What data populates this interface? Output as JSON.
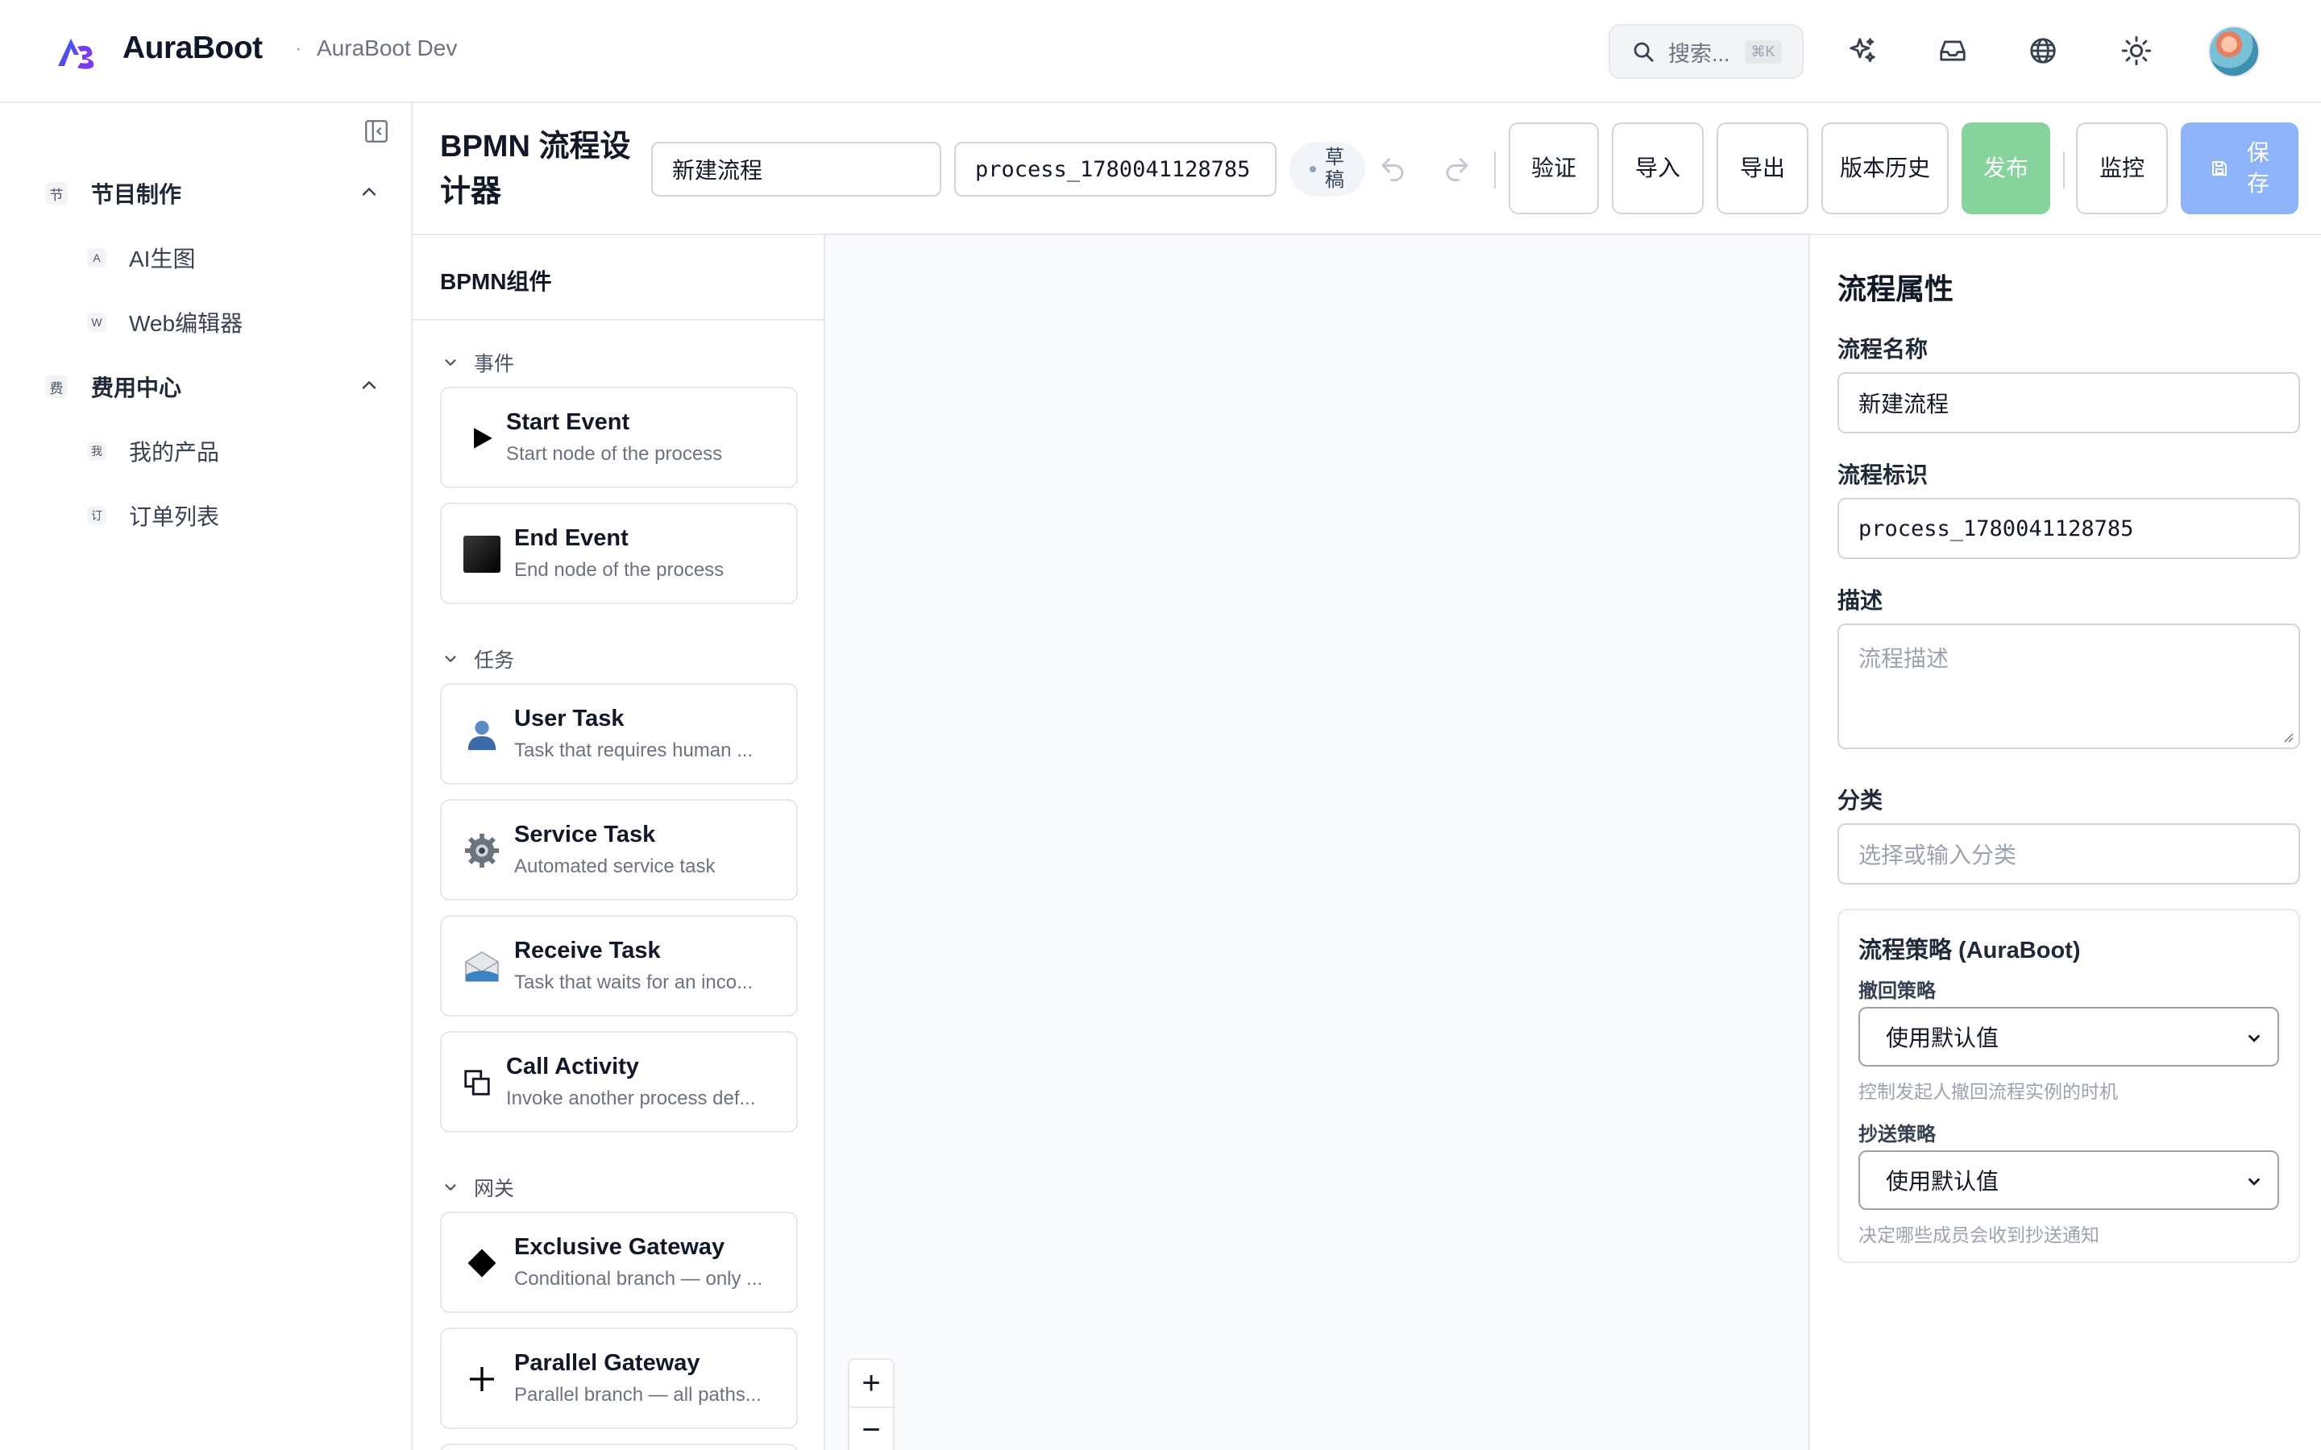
{
  "header": {
    "brand": "AuraBoot",
    "env_separator": "·",
    "env": "AuraBoot Dev",
    "search_placeholder": "搜索...",
    "search_shortcut": "⌘K",
    "icons": [
      "sparkle-icon",
      "inbox-icon",
      "globe-icon",
      "sun-icon"
    ]
  },
  "sidebar": {
    "groups": [
      {
        "badge": "节",
        "label": "节目制作",
        "items": [
          {
            "badge": "A",
            "label": "AI生图"
          },
          {
            "badge": "W",
            "label": "Web编辑器"
          }
        ]
      },
      {
        "badge": "费",
        "label": "费用中心",
        "items": [
          {
            "badge": "我",
            "label": "我的产品"
          },
          {
            "badge": "订",
            "label": "订单列表"
          }
        ]
      }
    ]
  },
  "toolbar": {
    "title": "BPMN 流程设计器",
    "process_name": "新建流程",
    "process_key": "process_1780041128785",
    "status": "草稿",
    "buttons": {
      "validate": "验证",
      "import": "导入",
      "export": "导出",
      "history": "版本历史",
      "publish": "发布",
      "monitor": "监控",
      "save": "保存"
    }
  },
  "palette": {
    "title": "BPMN组件",
    "sections": [
      {
        "label": "事件",
        "items": [
          {
            "name": "Start Event",
            "desc": "Start node of the process",
            "icon": "play-triangle-icon"
          },
          {
            "name": "End Event",
            "desc": "End node of the process",
            "icon": "black-square-icon"
          }
        ]
      },
      {
        "label": "任务",
        "items": [
          {
            "name": "User Task",
            "desc": "Task that requires human ...",
            "icon": "user-icon"
          },
          {
            "name": "Service Task",
            "desc": "Automated service task",
            "icon": "gear-icon"
          },
          {
            "name": "Receive Task",
            "desc": "Task that waits for an inco...",
            "icon": "envelope-icon"
          },
          {
            "name": "Call Activity",
            "desc": "Invoke another process def...",
            "icon": "overlap-squares-icon"
          }
        ]
      },
      {
        "label": "网关",
        "items": [
          {
            "name": "Exclusive Gateway",
            "desc": "Conditional branch — only ...",
            "icon": "diamond-icon"
          },
          {
            "name": "Parallel Gateway",
            "desc": "Parallel branch — all paths...",
            "icon": "plus-icon"
          }
        ]
      }
    ]
  },
  "canvas": {
    "zoom_in": "+",
    "zoom_out": "−"
  },
  "properties": {
    "title": "流程属性",
    "name_label": "流程名称",
    "name_value": "新建流程",
    "key_label": "流程标识",
    "key_value": "process_1780041128785",
    "desc_label": "描述",
    "desc_placeholder": "流程描述",
    "category_label": "分类",
    "category_placeholder": "选择或输入分类",
    "strategy": {
      "title": "流程策略 (AuraBoot)",
      "withdraw_label": "撤回策略",
      "withdraw_value": "使用默认值",
      "withdraw_help": "控制发起人撤回流程实例的时机",
      "cc_label": "抄送策略",
      "cc_value": "使用默认值",
      "cc_help": "决定哪些成员会收到抄送通知"
    }
  },
  "colors": {
    "publish_green": "#86d39b",
    "save_blue": "#8fb3f8",
    "canvas_bg": "#f8fafc"
  }
}
